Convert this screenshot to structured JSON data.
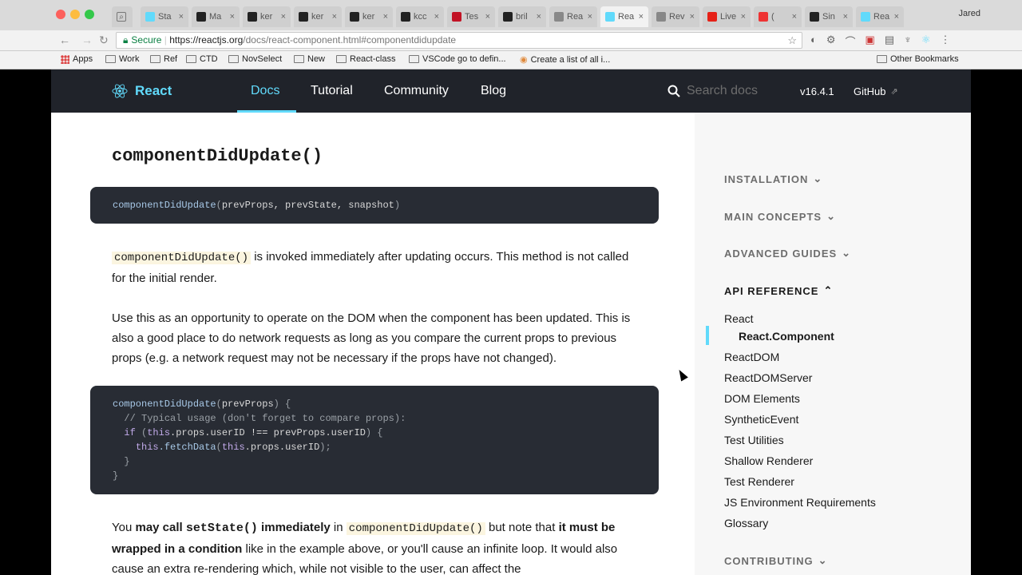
{
  "browser": {
    "tabs": [
      {
        "title": "Sta",
        "icon": "react-icon",
        "favcolor": "#61dafb"
      },
      {
        "title": "Ma",
        "icon": "github-icon",
        "favcolor": "#222"
      },
      {
        "title": "ker",
        "icon": "github-icon",
        "favcolor": "#222"
      },
      {
        "title": "ker",
        "icon": "github-icon",
        "favcolor": "#222"
      },
      {
        "title": "ker",
        "icon": "github-icon",
        "favcolor": "#222"
      },
      {
        "title": "kcc",
        "icon": "github-icon",
        "favcolor": "#222"
      },
      {
        "title": "Tes",
        "icon": "jest-icon",
        "favcolor": "#c21325"
      },
      {
        "title": "bril",
        "icon": "github-icon",
        "favcolor": "#222"
      },
      {
        "title": "Rea",
        "icon": "document-icon",
        "favcolor": "#888"
      },
      {
        "title": "Rea",
        "icon": "react-icon",
        "favcolor": "#61dafb",
        "active": true
      },
      {
        "title": "Rev",
        "icon": "document-icon",
        "favcolor": "#888"
      },
      {
        "title": "Live",
        "icon": "youtube-icon",
        "favcolor": "#e62117"
      },
      {
        "title": "(",
        "icon": "recording-icon",
        "favcolor": "#e33"
      },
      {
        "title": "Sin",
        "icon": "codesandbox-icon",
        "favcolor": "#222"
      },
      {
        "title": "Rea",
        "icon": "react-icon",
        "favcolor": "#61dafb"
      }
    ],
    "user": "Jared",
    "secure_label": "Secure",
    "url_host": "https://reactjs.org",
    "url_path": "/docs/react-component.html#componentdidupdate",
    "bookmarks": [
      {
        "label": "Apps",
        "icon": "apps-icon"
      },
      {
        "label": "Work",
        "icon": "folder-icon"
      },
      {
        "label": "Ref",
        "icon": "folder-icon"
      },
      {
        "label": "CTD",
        "icon": "folder-icon"
      },
      {
        "label": "NovSelect",
        "icon": "folder-icon"
      },
      {
        "label": "New",
        "icon": "folder-icon"
      },
      {
        "label": "React-class",
        "icon": "folder-icon"
      },
      {
        "label": "VSCode go to defin...",
        "icon": "folder-icon"
      },
      {
        "label": "Create a list of all i...",
        "icon": "page-icon"
      }
    ],
    "other_bookmarks": "Other Bookmarks"
  },
  "site": {
    "logo": "React",
    "nav": [
      {
        "label": "Docs",
        "active": true
      },
      {
        "label": "Tutorial"
      },
      {
        "label": "Community"
      },
      {
        "label": "Blog"
      }
    ],
    "search_placeholder": "Search docs",
    "version": "v16.4.1",
    "github": "GitHub"
  },
  "article": {
    "heading": "componentDidUpdate()",
    "signature": {
      "fn": "componentDidUpdate",
      "args": "prevProps, prevState, snapshot"
    },
    "p1": {
      "code": "componentDidUpdate()",
      "text": " is invoked immediately after updating occurs. This method is not called for the initial render."
    },
    "p2": "Use this as an opportunity to operate on the DOM when the component has been updated. This is also a good place to do network requests as long as you compare the current props to previous props (e.g. a network request may not be necessary if the props have not changed).",
    "example": {
      "l1_fn": "componentDidUpdate",
      "l1_arg": "prevProps",
      "l2_comment": "// Typical usage (don't forget to compare props):",
      "l3_if": "if",
      "l3_this": "this",
      "l3_props": ".props.userID",
      "l3_op": " !== ",
      "l3_prev": "prevProps.userID",
      "l4_this": "this",
      "l4_fetch": ".fetchData",
      "l4_arg_this": "this",
      "l4_arg_props": ".props.userID"
    },
    "p3": {
      "t1": "You ",
      "b1": "may call ",
      "c1": "setState()",
      "b2": " immediately",
      "t2": " in ",
      "c2": "componentDidUpdate()",
      "t3": " but note that ",
      "b3": "it must be wrapped in a condition",
      "t4": " like in the example above, or you'll cause an infinite loop. It would also cause an extra re-rendering which, while not visible to the user, can affect the"
    }
  },
  "sidebar": {
    "sections": [
      {
        "label": "INSTALLATION",
        "chevron": "down"
      },
      {
        "label": "MAIN CONCEPTS",
        "chevron": "down"
      },
      {
        "label": "ADVANCED GUIDES",
        "chevron": "down"
      },
      {
        "label": "API REFERENCE",
        "chevron": "up",
        "active": true
      },
      {
        "label": "CONTRIBUTING",
        "chevron": "down"
      }
    ],
    "items": [
      "React",
      "React.Component",
      "ReactDOM",
      "ReactDOMServer",
      "DOM Elements",
      "SyntheticEvent",
      "Test Utilities",
      "Shallow Renderer",
      "Test Renderer",
      "JS Environment Requirements",
      "Glossary"
    ]
  },
  "colors": {
    "react_accent": "#61dafb",
    "header_bg": "#20232a",
    "code_bg": "#282c34",
    "inline_code_bg": "#fbf5e0"
  }
}
